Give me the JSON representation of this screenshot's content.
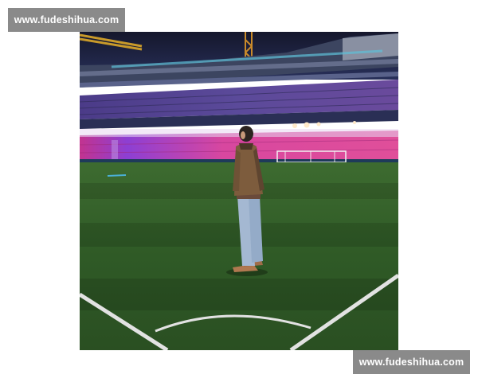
{
  "watermark": {
    "top_text": "www.fudeshihua.com",
    "bottom_text": "www.fudeshihua.com"
  },
  "photo": {
    "subject": "person standing on football pitch in illuminated stadium at night",
    "colors": {
      "sky": "#1b1f3a",
      "stands_pink": "#d7429c",
      "stands_purple": "#8a3fd0",
      "stands_blue": "#3a4a8c",
      "pitch": "#355f2a",
      "pitch_line": "#dcdcdc",
      "jacket": "#7a5a3c",
      "jeans": "#9fb3cf"
    }
  }
}
